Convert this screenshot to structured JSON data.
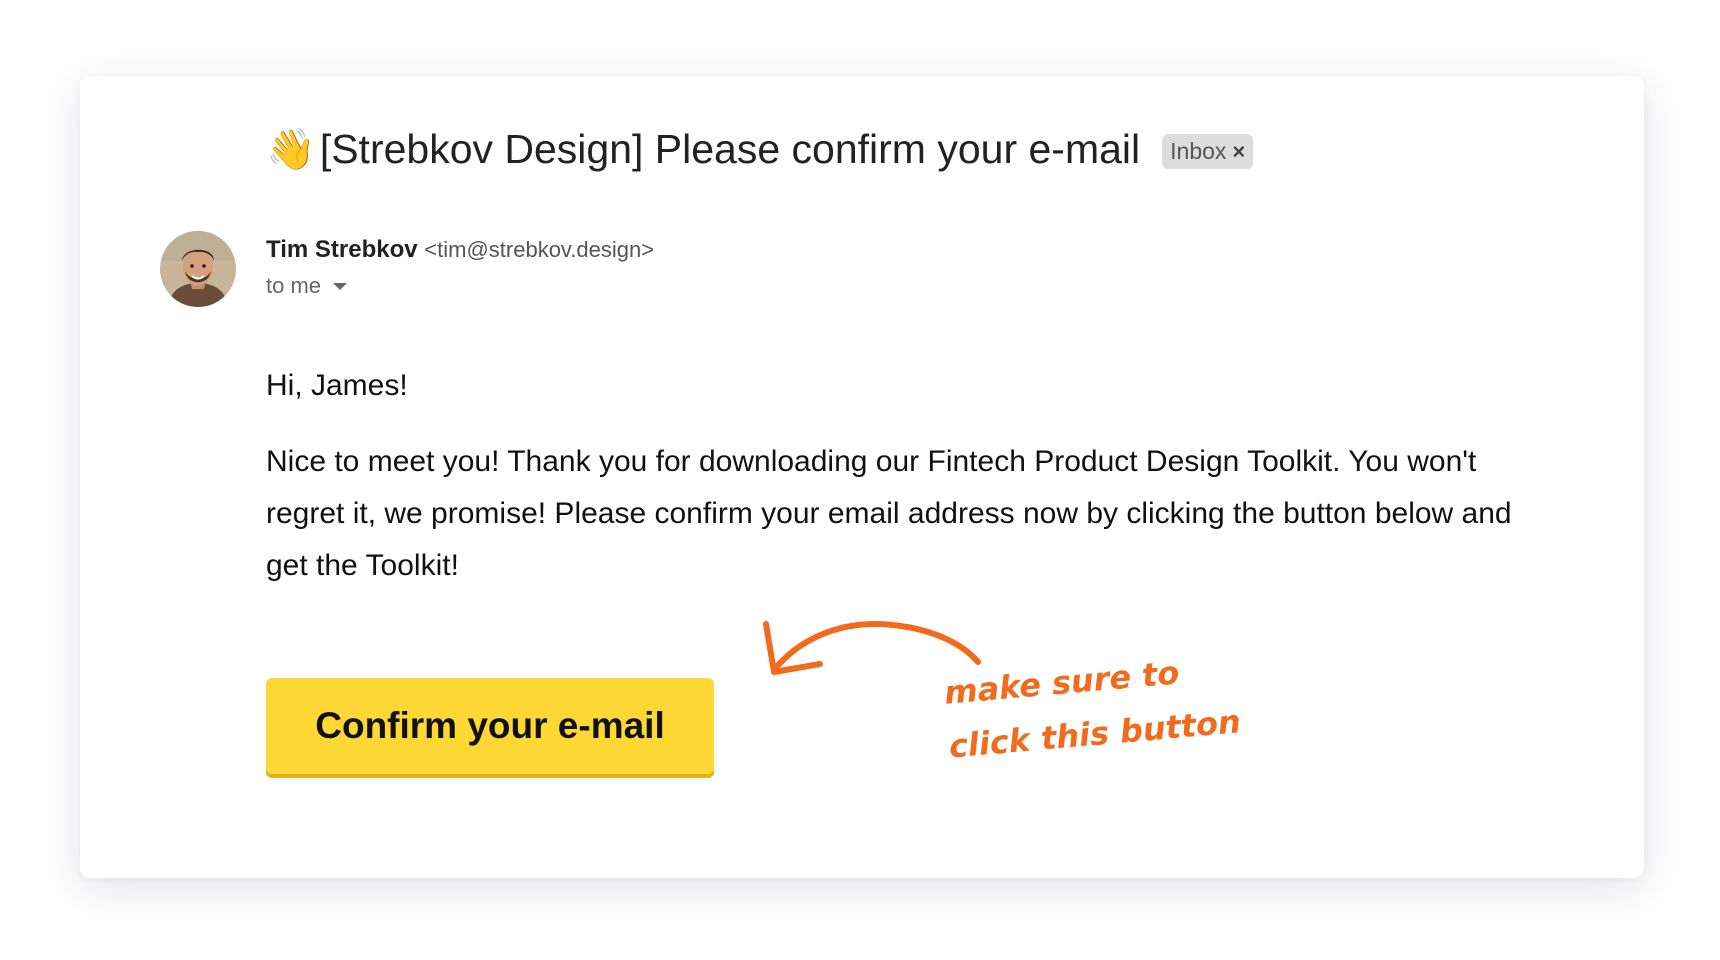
{
  "email": {
    "subject_icon": "waving-hand-icon",
    "subject_emoji": "👋",
    "subject": "[Strebkov Design] Please confirm your e-mail",
    "label_badge": "Inbox",
    "label_badge_remove": "×",
    "sender": {
      "avatar_icon": "person-photo",
      "name": "Tim Strebkov",
      "email": "<tim@strebkov.design>"
    },
    "recipient_text": "to me",
    "greeting": "Hi, James!",
    "body": "Nice to meet you! Thank you for downloading our Fintech Product Design Toolkit. You won't regret it, we promise! Please confirm your email address now by clicking the button below and get the Toolkit!",
    "cta_button": "Confirm your e-mail"
  },
  "annotation": {
    "line1": "make sure to",
    "line2": "click this button",
    "color": "#f26a1b"
  },
  "colors": {
    "button": "#fdd835",
    "button_shadow": "#e2b21a",
    "badge": "#dddddd",
    "background": "#ffffff"
  }
}
